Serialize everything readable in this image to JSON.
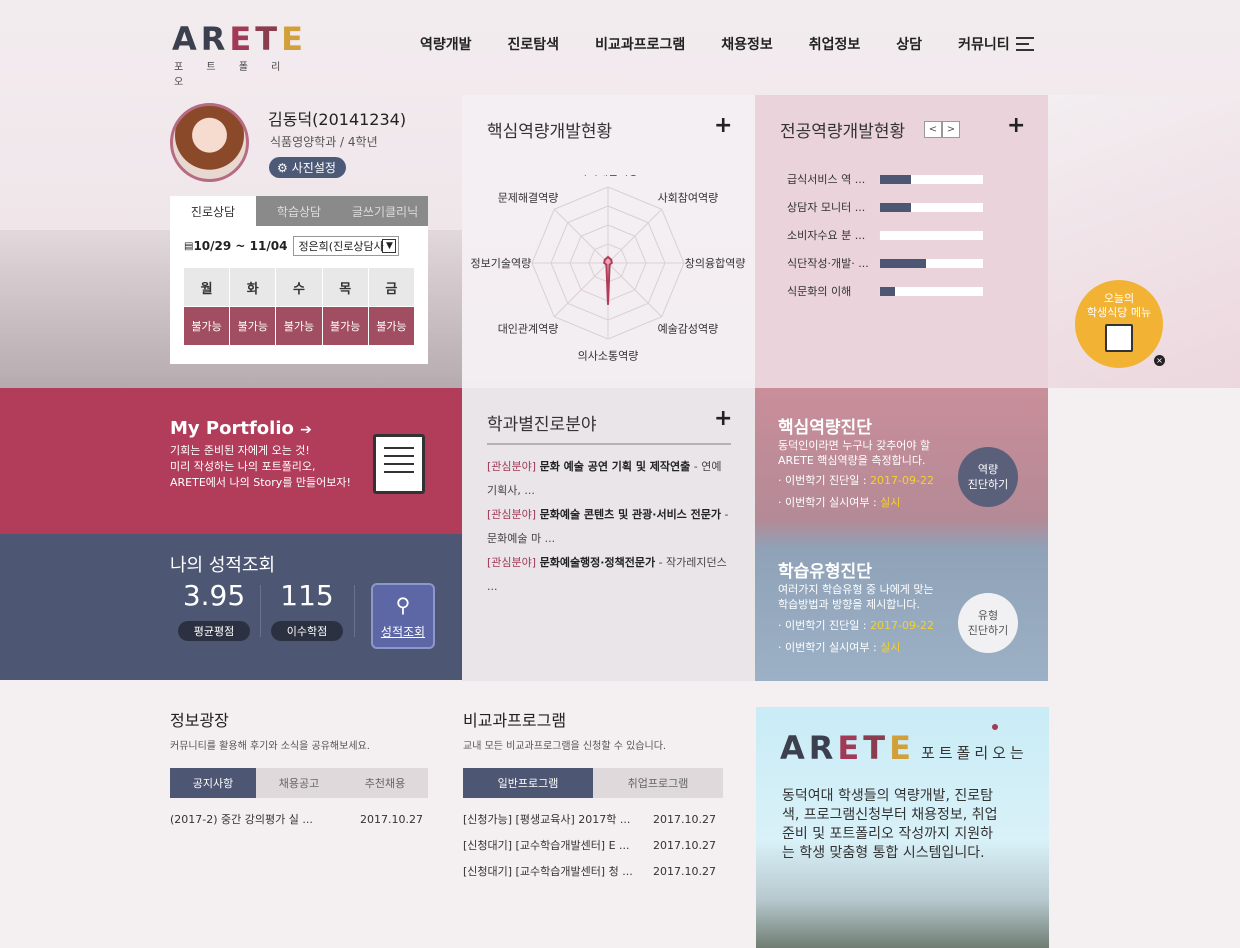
{
  "header": {
    "logo_word": [
      "A",
      "R",
      "E",
      "T",
      "E"
    ],
    "logo_sub": "포 트 폴 리 오",
    "nav": [
      "역량개발",
      "진로탐색",
      "비교과프로그램",
      "채용정보",
      "취업정보",
      "상담",
      "커뮤니티"
    ]
  },
  "profile": {
    "name": "김동덕(20141234)",
    "dept": "식품영양학과 / 4학년",
    "photo_button": "사진설정"
  },
  "counsel": {
    "tabs": [
      "진로상담",
      "학습상담",
      "글쓰기클리닉"
    ],
    "date_range": "10/29 ~ 11/04",
    "counselor": "정은희(진로상담사",
    "days": [
      "월",
      "화",
      "수",
      "목",
      "금"
    ],
    "slots": [
      "불가능",
      "불가능",
      "불가능",
      "불가능",
      "불가능"
    ]
  },
  "core": {
    "title": "핵심역량개발현황",
    "plus": "+",
    "radar": {
      "axes": [
        "자기개발역량",
        "사회참여역량",
        "창의융합역량",
        "예술감성역량",
        "의사소통역량",
        "대인관계역량",
        "정보기술역량",
        "문제해결역량"
      ],
      "values": [
        0.08,
        0.06,
        0.05,
        0.03,
        0.55,
        0.03,
        0.05,
        0.06
      ],
      "fill": "#e9a7b7",
      "stroke": "#b23c5a"
    }
  },
  "major": {
    "title": "전공역량개발현황",
    "prev": "<",
    "next": ">",
    "plus": "+",
    "bars": [
      {
        "label": "급식서비스 역 ...",
        "value": 0.3
      },
      {
        "label": "상담자 모니터 ...",
        "value": 0.3
      },
      {
        "label": "소비자수요 분 ...",
        "value": 0
      },
      {
        "label": "식단작성·개발· ...",
        "value": 0.45
      },
      {
        "label": "식문화의 이해",
        "value": 0.15
      }
    ]
  },
  "portfolio": {
    "title": "My Portfolio",
    "lines": [
      "기회는 준비된 자에게 오는 것!",
      "미리 작성하는 나의 포트폴리오,",
      "ARETE에서 나의 Story를 만들어보자!"
    ]
  },
  "grade": {
    "title": "나의 성적조회",
    "gpa": "3.95",
    "gpa_label": "평균평점",
    "credits": "115",
    "credits_label": "이수학점",
    "button": "성적조회"
  },
  "career": {
    "title": "학과별진로분야",
    "plus": "+",
    "items": [
      {
        "tag": "[관심분야]",
        "field": "문화 예술 공연 기획 및 제작연출",
        "rest": " - 연예기획사, ..."
      },
      {
        "tag": "[관심분야]",
        "field": "문화예술 콘텐츠 및 관광·서비스 전문가",
        "rest": " - 문화예술 마 ..."
      },
      {
        "tag": "[관심분야]",
        "field": "문화예술행정·정책전문가",
        "rest": " - 작가레지던스 ..."
      }
    ]
  },
  "diag": {
    "core_title": "핵심역량진단",
    "core_text": [
      "동덕인이라면 누구나 갖추어야 할",
      "ARETE 핵심역량을 측정합니다."
    ],
    "core_date_label": "· 이번학기 진단일 : ",
    "core_date": "2017-09-22",
    "core_done_label": "· 이번학기 실시여부 : ",
    "core_done": "실시",
    "core_button": [
      "역량",
      "진단하기"
    ],
    "learn_title": "학습유형진단",
    "learn_text": [
      "여러가지 학습유형 중 나에게 맞는",
      "학습방법과 방향을 제시합니다."
    ],
    "learn_date_label": "· 이번학기 진단일 : ",
    "learn_date": "2017-09-22",
    "learn_done_label": "· 이번학기 실시여부 : ",
    "learn_done": "실시",
    "learn_button": [
      "유형",
      "진단하기"
    ]
  },
  "cafe": {
    "lines": [
      "오늘의",
      "학생식당 메뉴"
    ],
    "close": "×"
  },
  "info": {
    "title": "정보광장",
    "sub": "커뮤니티를 활용해 후기와 소식을 공유해보세요.",
    "tabs": [
      "공지사항",
      "채용공고",
      "추천채용"
    ],
    "rows": [
      {
        "text": "(2017-2) 중간 강의평가 실 ...",
        "date": "2017.10.27"
      }
    ]
  },
  "program": {
    "title": "비교과프로그램",
    "sub": "교내 모든 비교과프로그램을 신청할 수 있습니다.",
    "tabs": [
      "일반프로그램",
      "취업프로그램"
    ],
    "rows": [
      {
        "text": "[신청가능] [평생교육사] 2017학 ...",
        "date": "2017.10.27"
      },
      {
        "text": "[신청대기] [교수학습개발센터] E ...",
        "date": "2017.10.27"
      },
      {
        "text": "[신청대기] [교수학습개발센터] 청 ...",
        "date": "2017.10.27"
      }
    ]
  },
  "promo": {
    "logo_suffix": "포트폴리오는",
    "lines": [
      "동덕여대 학생들의 역량개발, 진로탐",
      "색, 프로그램신청부터 채용정보, 취업",
      "준비 및 포트폴리오 작성까지 지원하",
      "는 학생 맞춤형 통합 시스템입니다."
    ]
  }
}
